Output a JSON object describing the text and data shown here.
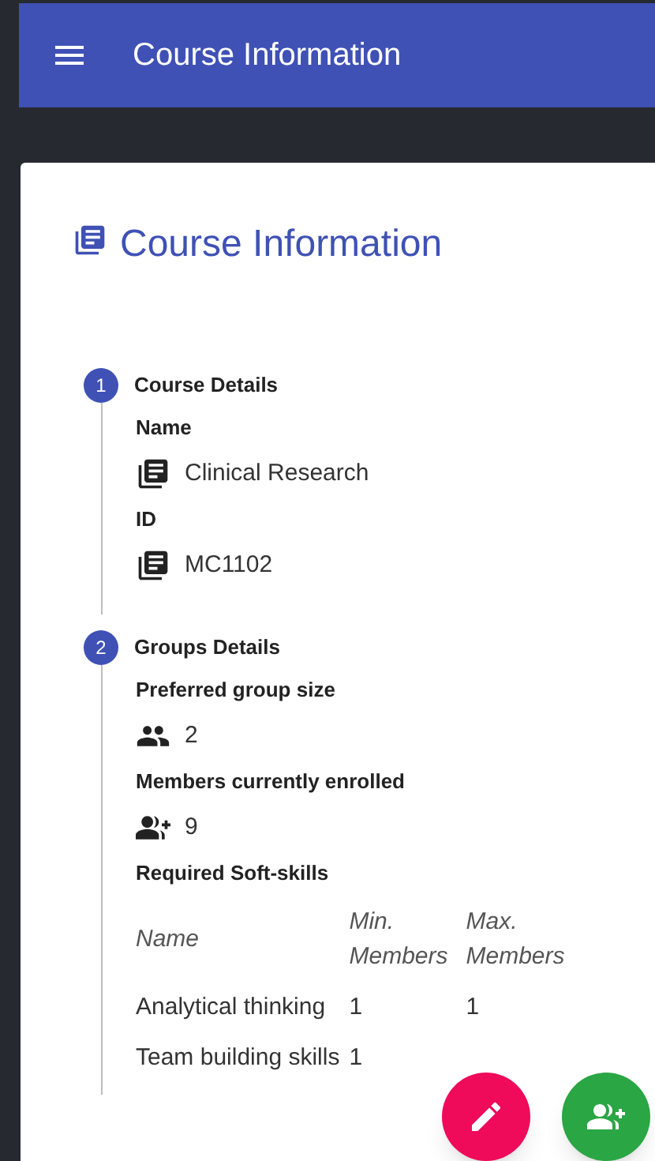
{
  "app_bar": {
    "title": "Course Information"
  },
  "page_title": "Course Information",
  "steps": [
    {
      "number": "1",
      "title": "Course Details",
      "fields": [
        {
          "label": "Name",
          "kind": "book",
          "value": "Clinical Research"
        },
        {
          "label": "ID",
          "kind": "book",
          "value": "MC1102"
        }
      ]
    },
    {
      "number": "2",
      "title": "Groups Details",
      "fields": [
        {
          "label": "Preferred group size",
          "kind": "people",
          "value": "2"
        },
        {
          "label": "Members currently enrolled",
          "kind": "add-people",
          "value": "9"
        }
      ],
      "table": {
        "title": "Required Soft-skills",
        "columns": [
          "Name",
          "Min. Members",
          "Max. Members"
        ],
        "rows": [
          [
            "Analytical thinking",
            "1",
            "1"
          ],
          [
            "Team building skills",
            "1"
          ]
        ]
      }
    }
  ],
  "fabs": [
    {
      "kind": "edit",
      "color": "#ef0a5a"
    },
    {
      "kind": "add-group",
      "color": "#2aa644"
    }
  ]
}
